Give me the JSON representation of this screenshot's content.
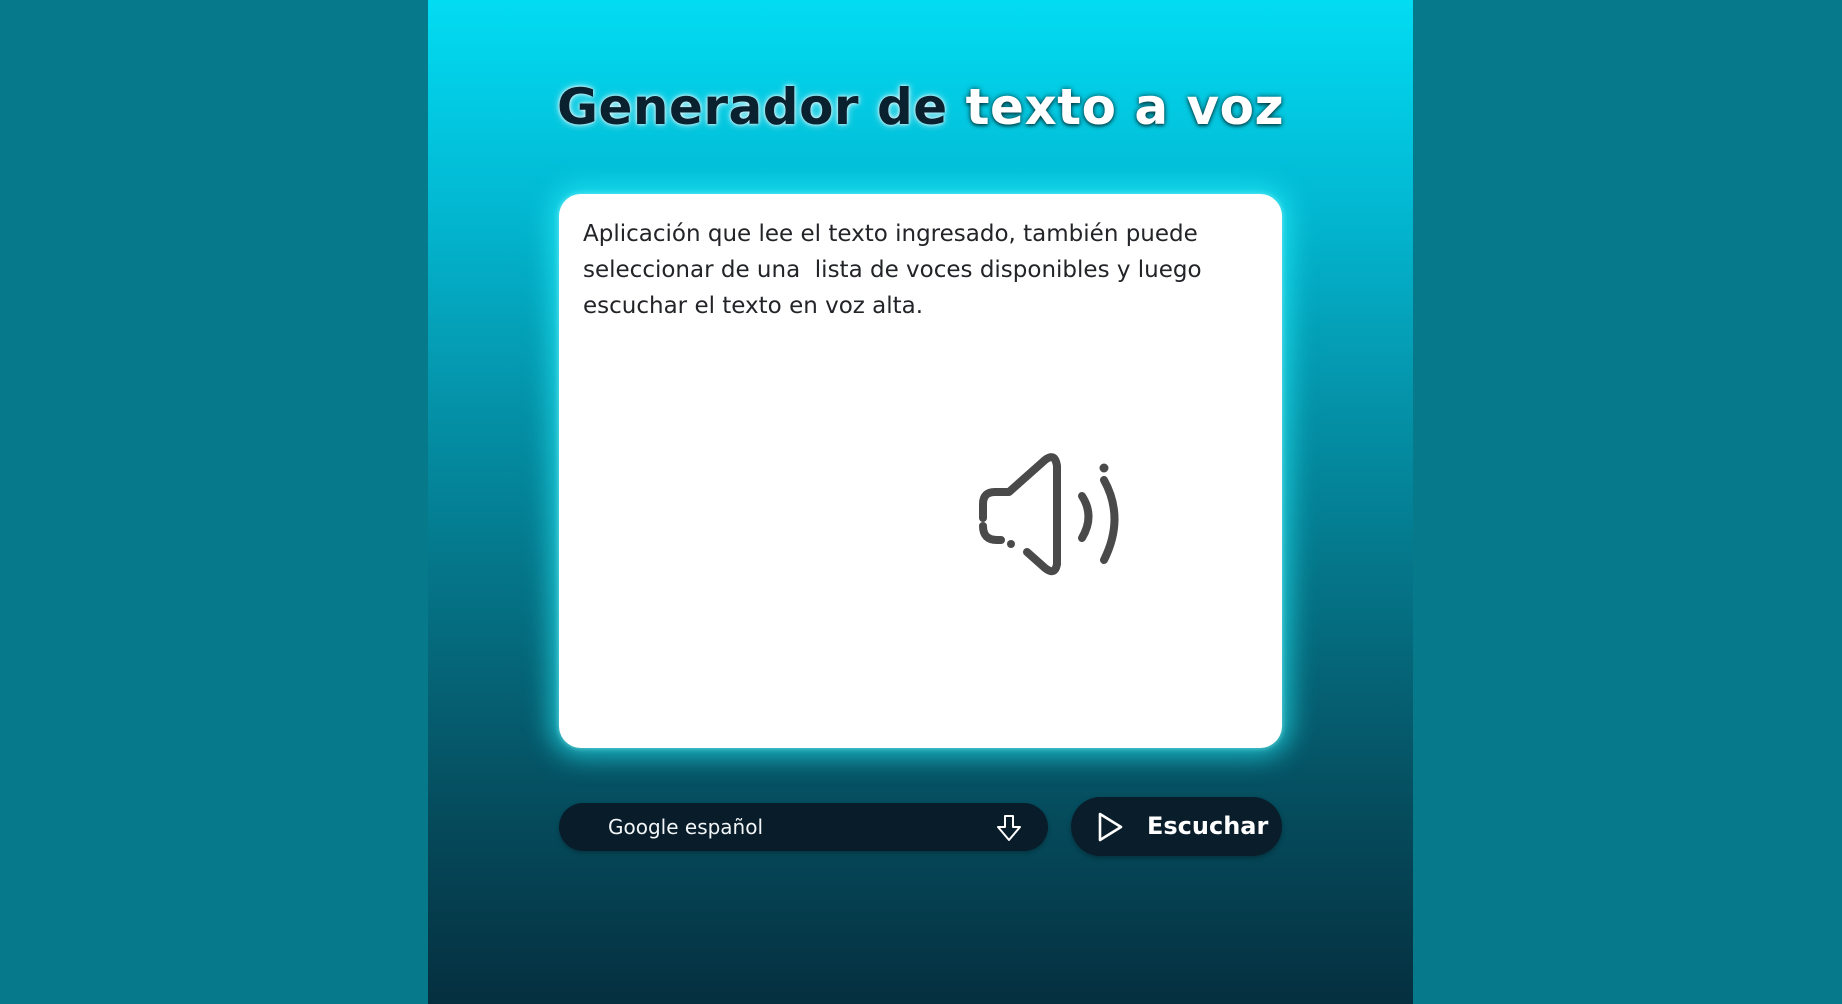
{
  "colors": {
    "outer_background": "#067a8b",
    "panel_gradient_top": "#02dcf3",
    "panel_gradient_bottom": "#052f3f",
    "card_background": "#ffffff",
    "control_background": "#091c2a",
    "title_dark": "#0a2230",
    "title_light": "#ffffff"
  },
  "header": {
    "title_part1": "Generador de",
    "title_part2": "texto a voz"
  },
  "text_input": {
    "value": "Aplicación que lee el texto ingresado, también puede seleccionar de una  lista de voces disponibles y luego escuchar el texto en voz alta."
  },
  "illustration": {
    "icon": "speaker-volume-icon"
  },
  "voice_select": {
    "selected": "Google español",
    "arrow_icon": "download-arrow-icon"
  },
  "listen_button": {
    "label": "Escuchar",
    "icon": "play-icon"
  }
}
